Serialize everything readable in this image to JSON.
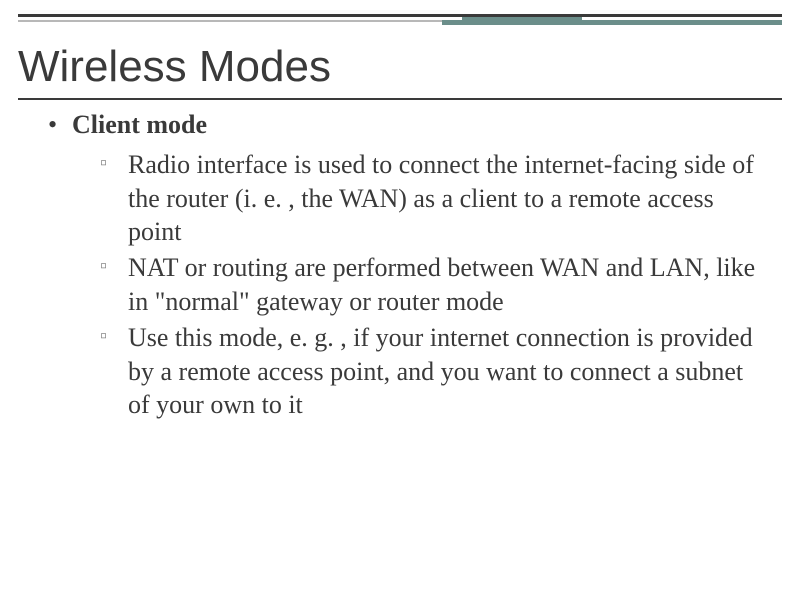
{
  "title": "Wireless Modes",
  "list": {
    "heading": "Client mode",
    "items": [
      " Radio interface is used to connect the internet-facing side of the router (i. e. , the WAN) as a client to a remote access point",
      "NAT or routing are performed between WAN and LAN, like in \"normal\" gateway or router mode",
      "Use this mode, e. g. , if your internet connection is provided by a remote access point, and you want to connect a subnet of your own to it"
    ]
  }
}
